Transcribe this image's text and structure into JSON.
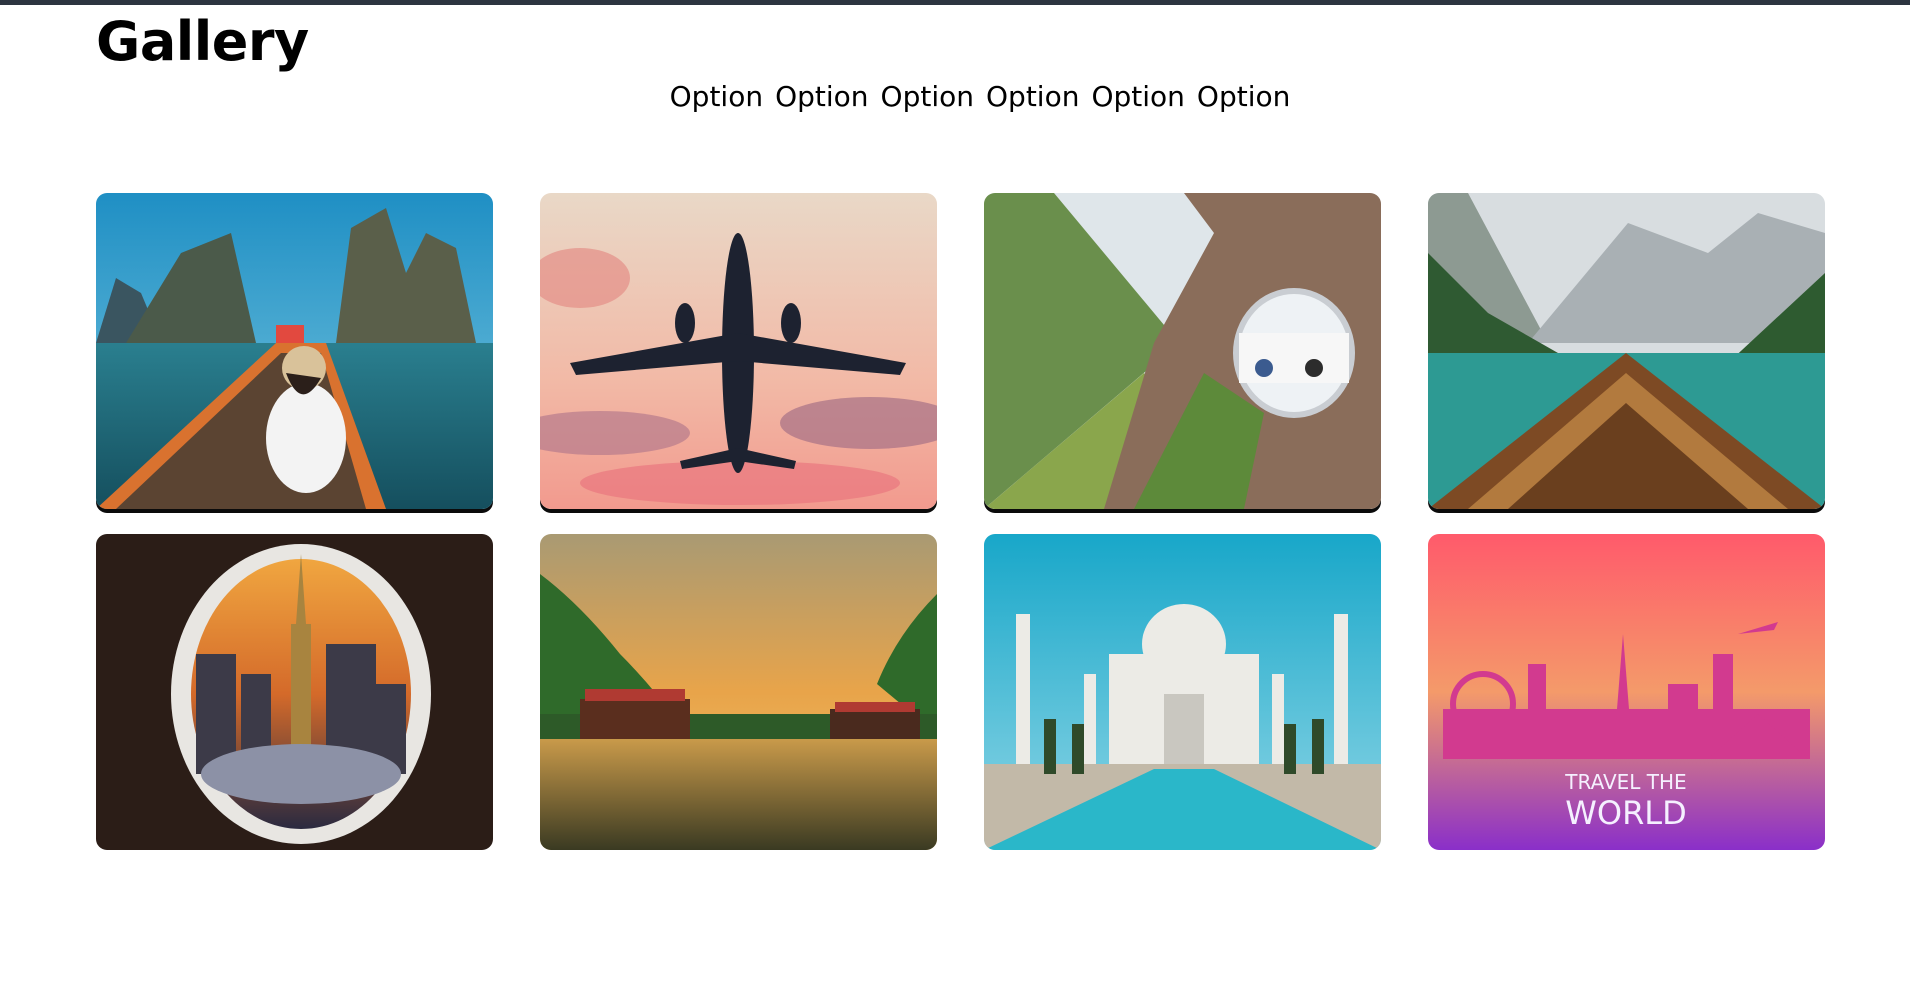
{
  "header": {
    "title": "Gallery"
  },
  "nav": {
    "options": [
      "Option",
      "Option",
      "Option",
      "Option",
      "Option",
      "Option"
    ]
  },
  "gallery": {
    "items": [
      {
        "icon": "woman-on-longtail-boat-image"
      },
      {
        "icon": "airplane-sunset-image"
      },
      {
        "icon": "cliff-sky-pod-image"
      },
      {
        "icon": "lake-boat-mountains-image"
      },
      {
        "icon": "airplane-window-city-image"
      },
      {
        "icon": "houseboat-river-sunset-image"
      },
      {
        "icon": "taj-mahal-image"
      },
      {
        "icon": "travel-the-world-poster-image",
        "text_line1": "TRAVEL THE",
        "text_line2": "WORLD"
      }
    ]
  },
  "colors": {
    "topbar": "#2d3540",
    "poster_top": "#ff6a6a",
    "poster_bottom": "#8a2fc9"
  }
}
